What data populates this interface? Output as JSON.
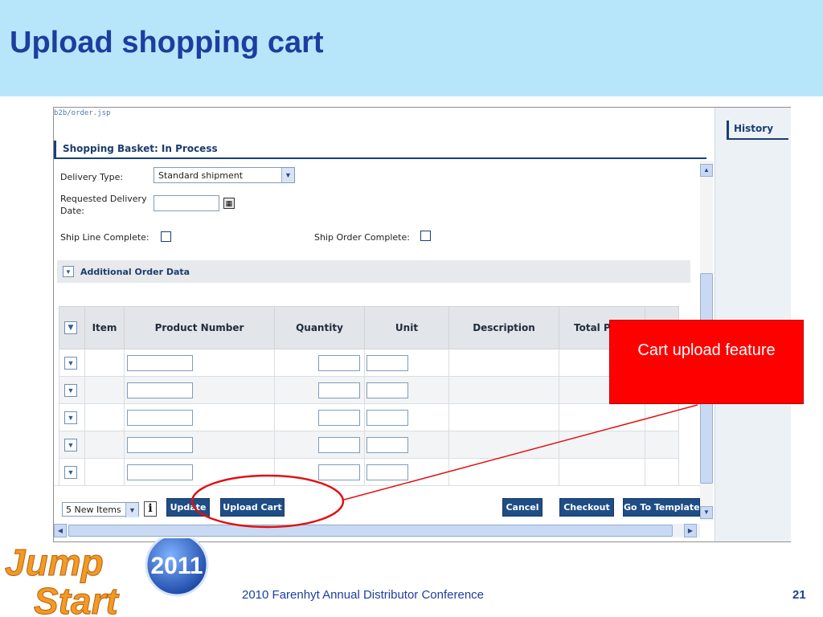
{
  "slide": {
    "title": "Upload shopping cart",
    "footer": "2010 Farenhyt Annual Distributor Conference",
    "page_number": "21",
    "callout": "Cart upload feature",
    "logo": {
      "word1": "Jump",
      "word2": "Start",
      "year": "2011"
    }
  },
  "screen": {
    "url": "b2b/order.jsp",
    "panel_title": "Shopping Basket: In Process",
    "history_tab": "History",
    "form": {
      "delivery_type_label": "Delivery Type:",
      "delivery_type_value": "Standard shipment",
      "requested_date_label_1": "Requested Delivery",
      "requested_date_label_2": "Date:",
      "requested_date_value": "",
      "ship_line_complete_label": "Ship Line Complete:",
      "ship_order_complete_label": "Ship Order Complete:"
    },
    "section": {
      "label": "Additional Order Data"
    },
    "table": {
      "columns": [
        "Item",
        "Product Number",
        "Quantity",
        "Unit",
        "Description",
        "Total Pr"
      ],
      "row_count": 5
    },
    "actions": {
      "items_select": "5 New Items",
      "update": "Update",
      "upload_cart": "Upload Cart",
      "cancel": "Cancel",
      "checkout": "Checkout",
      "go_to_template": "Go To Template"
    }
  },
  "colors": {
    "title_band": "#b7e6fb",
    "title_text": "#1c3ea0",
    "button_blue": "#1f4d86",
    "callout_red": "#ff0000"
  }
}
